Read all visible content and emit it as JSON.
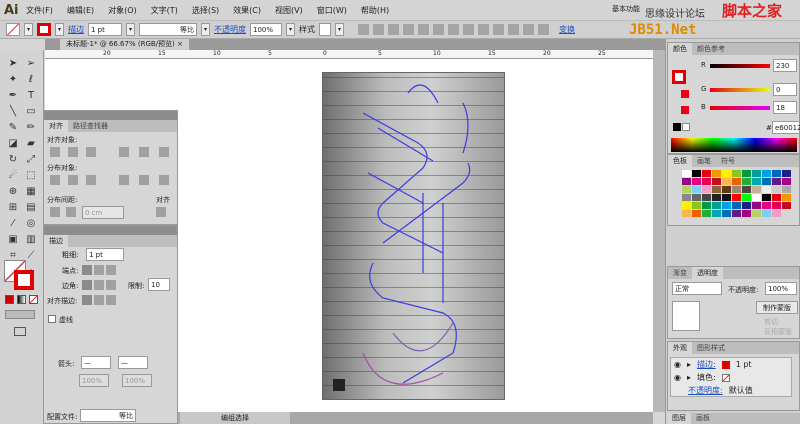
{
  "app": {
    "logo": "Ai",
    "workspace": "基本功能",
    "watermark_cn": "思缘设计论坛",
    "watermark_site1": "脚本之家",
    "watermark_site2": "JB51.Net"
  },
  "menu": [
    "文件(F)",
    "编辑(E)",
    "对象(O)",
    "文字(T)",
    "选择(S)",
    "效果(C)",
    "视图(V)",
    "窗口(W)",
    "帮助(H)"
  ],
  "control": {
    "stroke_link": "描边",
    "stroke_weight": "1 pt",
    "profile": "等比",
    "opacity_link": "不透明度",
    "opacity": "100%",
    "style_label": "样式",
    "transform_link": "变换"
  },
  "document": {
    "tab": "未标题-1* @ 66.67% (RGB/预览)",
    "ruler": [
      "20",
      "15",
      "10",
      "5",
      "0",
      "5",
      "10",
      "15",
      "20",
      "25"
    ],
    "status": "编组选择"
  },
  "align": {
    "tabs": [
      "对齐",
      "路径查找器"
    ],
    "align_objects": "对齐对象:",
    "distribute_objects": "分布对象:",
    "distribute_spacing": "分布间距:",
    "align_to": "对齐",
    "spacing_value": "0 cm"
  },
  "stroke": {
    "tab": "描边",
    "weight_label": "粗细:",
    "weight": "1 pt",
    "cap_label": "端点:",
    "corner_label": "边角:",
    "limit_label": "限制:",
    "limit": "10",
    "align_label": "对齐描边:",
    "dashed": "虚线",
    "arrow_label": "箭头:",
    "scale1": "100%",
    "scale2": "100%",
    "profile_label": "配置文件:",
    "profile": "等比"
  },
  "color": {
    "tabs": [
      "颜色",
      "颜色参考"
    ],
    "r_label": "R",
    "g_label": "G",
    "b_label": "B",
    "r": "230",
    "g": "0",
    "b": "18",
    "hex_label": "#",
    "hex": "e60012",
    "accent": "#e60012"
  },
  "swatches": {
    "tabs": [
      "色板",
      "画笔",
      "符号"
    ]
  },
  "transparency": {
    "tabs": [
      "渐变",
      "透明度"
    ],
    "mode": "正常",
    "opacity_label": "不透明度:",
    "opacity": "100%",
    "mask_button": "制作蒙版",
    "clip": "剪切",
    "invert": "反相蒙版"
  },
  "appearance": {
    "tabs": [
      "外观",
      "图形样式"
    ],
    "rows": [
      {
        "label": "描边:",
        "value": "1 pt"
      },
      {
        "label": "填色:",
        "value": ""
      },
      {
        "label": "不透明度:",
        "value": "默认值"
      }
    ]
  },
  "layers": {
    "tabs": [
      "图层",
      "画板"
    ]
  }
}
